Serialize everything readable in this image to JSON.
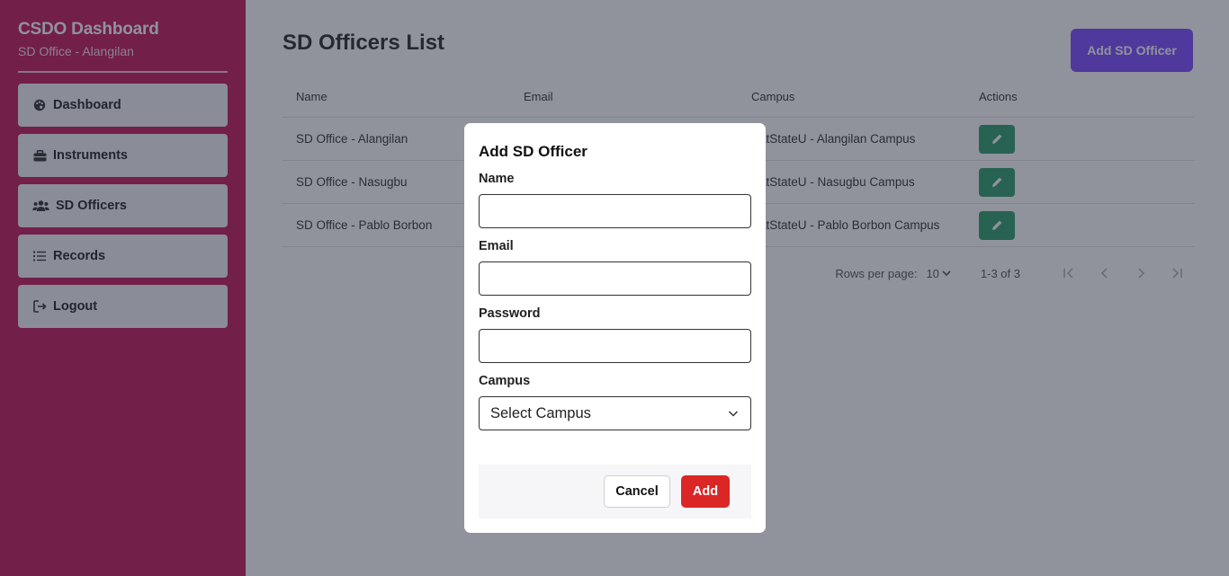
{
  "sidebar": {
    "title": "CSDO Dashboard",
    "subtitle": "SD Office - Alangilan",
    "items": [
      {
        "label": "Dashboard",
        "icon": "palette-icon"
      },
      {
        "label": "Instruments",
        "icon": "toolbox-icon"
      },
      {
        "label": "SD Officers",
        "icon": "users-icon"
      },
      {
        "label": "Records",
        "icon": "list-icon"
      },
      {
        "label": "Logout",
        "icon": "logout-icon"
      }
    ],
    "bg_color": "#c2185b"
  },
  "main": {
    "title": "SD Officers List",
    "add_button": "Add SD Officer",
    "table": {
      "headers": [
        "Name",
        "Email",
        "Campus",
        "Actions"
      ],
      "rows": [
        {
          "name": "SD Office - Alangilan",
          "email": "",
          "campus": "BatStateU - Alangilan Campus"
        },
        {
          "name": "SD Office - Nasugbu",
          "email": "",
          "campus": "BatStateU - Nasugbu Campus"
        },
        {
          "name": "SD Office - Pablo Borbon",
          "email": "",
          "campus": "BatStateU - Pablo Borbon Campus"
        }
      ]
    },
    "pagination": {
      "rows_per_page_label": "Rows per page:",
      "rows_per_page_value": "10",
      "range": "1-3 of 3"
    }
  },
  "modal": {
    "title": "Add SD Officer",
    "name_label": "Name",
    "name_value": "",
    "email_label": "Email",
    "email_value": "",
    "password_label": "Password",
    "password_value": "",
    "campus_label": "Campus",
    "campus_selected": "Select Campus",
    "cancel_label": "Cancel",
    "add_label": "Add"
  },
  "colors": {
    "accent": "#7c4dff",
    "edit": "#2e9e6c",
    "danger": "#dc2626"
  }
}
